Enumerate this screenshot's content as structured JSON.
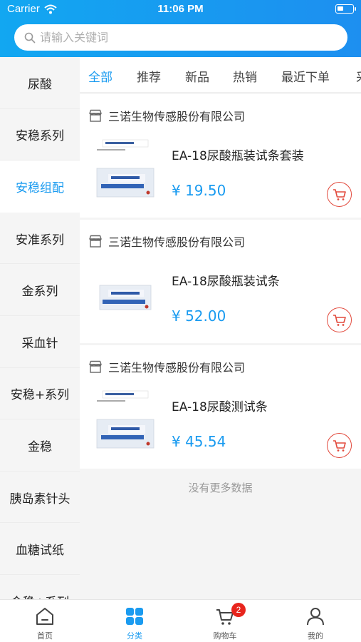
{
  "status_bar": {
    "carrier": "Carrier",
    "time": "11:06 PM"
  },
  "search": {
    "placeholder": "请输入关键词"
  },
  "sidebar": {
    "items": [
      {
        "label": "尿酸"
      },
      {
        "label": "安稳系列"
      },
      {
        "label": "安稳组配"
      },
      {
        "label": "安准系列"
      },
      {
        "label": "金系列"
      },
      {
        "label": "采血针"
      },
      {
        "label": "安稳+系列"
      },
      {
        "label": "金稳"
      },
      {
        "label": "胰岛素针头"
      },
      {
        "label": "血糖试纸"
      },
      {
        "label": "金稳+系列"
      }
    ],
    "active_index": 2
  },
  "tabs": [
    {
      "label": "全部"
    },
    {
      "label": "推荐"
    },
    {
      "label": "新品"
    },
    {
      "label": "热销"
    },
    {
      "label": "最近下单"
    },
    {
      "label": "采购"
    }
  ],
  "products": [
    {
      "shop": "三诺生物传感股份有限公司",
      "name": "EA-18尿酸瓶装试条套装",
      "price": "¥ 19.50"
    },
    {
      "shop": "三诺生物传感股份有限公司",
      "name": "EA-18尿酸瓶装试条",
      "price": "¥ 52.00"
    },
    {
      "shop": "三诺生物传感股份有限公司",
      "name": "EA-18尿酸测试条",
      "price": "¥ 45.54"
    }
  ],
  "no_more_text": "没有更多数据",
  "tabbar": {
    "items": [
      {
        "label": "首页",
        "icon": "home-icon"
      },
      {
        "label": "分类",
        "icon": "category-icon"
      },
      {
        "label": "购物车",
        "icon": "cart-icon"
      },
      {
        "label": "我的",
        "icon": "user-icon"
      }
    ],
    "cart_badge": "2"
  },
  "colors": {
    "accent": "#1a9bf0",
    "header": "#1d8ff0",
    "cart_button": "#e24a3d",
    "badge": "#e8251d"
  }
}
